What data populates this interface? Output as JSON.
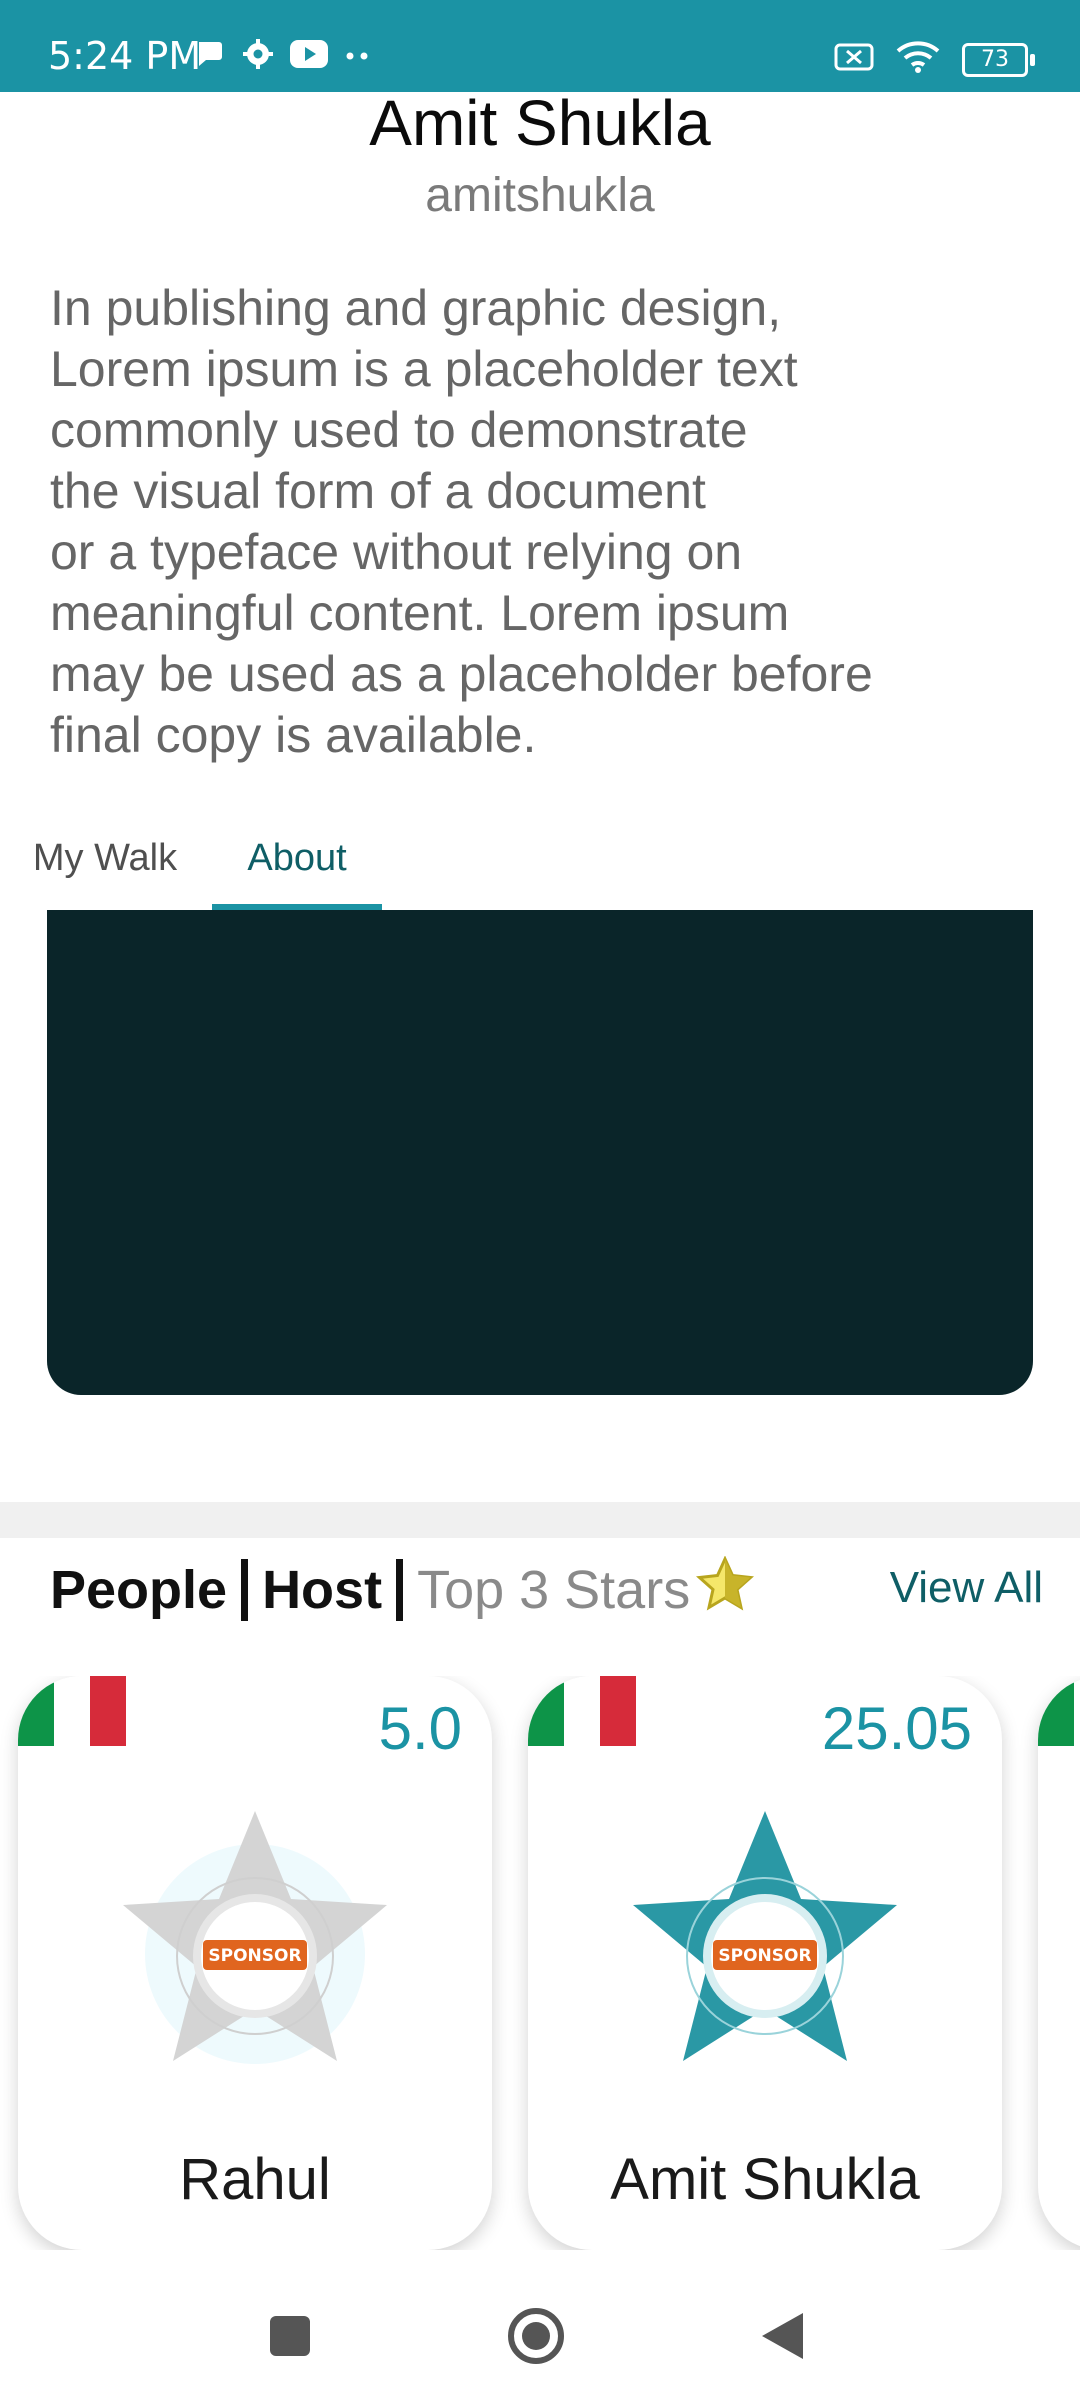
{
  "status_bar": {
    "time": "5:24 PM",
    "battery": "73",
    "icons_left": [
      "chat-icon",
      "gear-icon",
      "youtube-icon",
      "more-dots-icon"
    ],
    "icons_right": [
      "no-sim-icon",
      "wifi-icon",
      "battery-icon"
    ]
  },
  "profile": {
    "name": "Amit Shukla",
    "username": "amitshukla",
    "bio_lines": [
      "In publishing and graphic design,",
      "Lorem ipsum is a placeholder text",
      "commonly used to demonstrate",
      "the visual form of a document",
      "or a typeface without relying on",
      "meaningful content. Lorem ipsum",
      "may be used as a placeholder before",
      "final copy is available."
    ]
  },
  "tabs": [
    {
      "label": "My Walk",
      "active": false
    },
    {
      "label": "About",
      "active": true
    }
  ],
  "people_section": {
    "people_label": "People",
    "host_label": "Host",
    "top3_label": "Top 3 Stars",
    "view_all_label": "View All"
  },
  "cards": [
    {
      "name": "Rahul",
      "score": "5.0",
      "badge_color": "grey",
      "badge_text": "SPONSOR"
    },
    {
      "name": "Amit Shukla",
      "score": "25.05",
      "badge_color": "teal",
      "badge_text": "SPONSOR"
    }
  ],
  "colors": {
    "accent": "#1b93a4",
    "tab_active": "#0f5e66",
    "video_bg": "#0a2529",
    "flag_green": "#0d9448",
    "flag_red": "#d62b3a"
  },
  "nav": {
    "icons": [
      "recent-apps-icon",
      "home-icon",
      "back-icon"
    ]
  }
}
